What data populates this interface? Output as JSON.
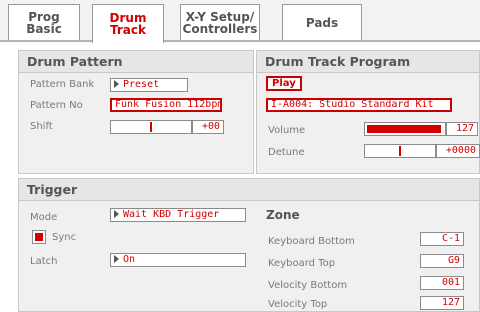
{
  "tabs": [
    {
      "line1": "Prog",
      "line2": "Basic",
      "active": false
    },
    {
      "line1": "Drum",
      "line2": "Track",
      "active": true
    },
    {
      "line1": "X-Y Setup/",
      "line2": "Controllers",
      "active": false
    },
    {
      "line1": "Pads",
      "line2": "",
      "active": false
    }
  ],
  "drum_pattern": {
    "title": "Drum Pattern",
    "bank_label": "Pattern Bank",
    "bank_value": "Preset",
    "no_label": "Pattern No",
    "no_value": "Funk Fusion 112bpm",
    "shift_label": "Shift",
    "shift_value": "+00",
    "shift_level": 0.5
  },
  "program": {
    "title": "Drum Track Program",
    "play_label": "Play",
    "kit_value": "I-A004: Studio Standard Kit",
    "volume_label": "Volume",
    "volume_value": "127",
    "volume_level": 1.0,
    "detune_label": "Detune",
    "detune_value": "+0000",
    "detune_level": 0.5
  },
  "trigger": {
    "title": "Trigger",
    "mode_label": "Mode",
    "mode_value": "Wait KBD Trigger",
    "sync_label": "Sync",
    "sync_checked": true,
    "latch_label": "Latch",
    "latch_value": "On"
  },
  "zone": {
    "title": "Zone",
    "kb_bottom_label": "Keyboard Bottom",
    "kb_bottom_value": "C-1",
    "kb_top_label": "Keyboard Top",
    "kb_top_value": "G9",
    "vel_bottom_label": "Velocity Bottom",
    "vel_bottom_value": "001",
    "vel_top_label": "Velocity Top",
    "vel_top_value": "127"
  },
  "colors": {
    "accent": "#d40000",
    "panel": "#f0f0f0",
    "title_bar": "#e6e6e6"
  }
}
